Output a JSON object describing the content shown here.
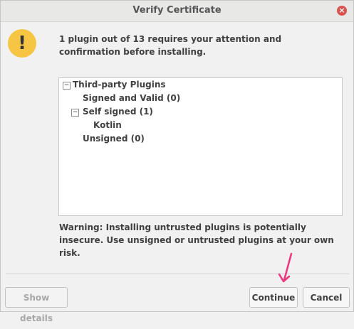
{
  "window": {
    "title": "Verify Certificate",
    "close_icon": "×"
  },
  "message": {
    "icon": "!",
    "text": "1 plugin out of 13 requires your attention and confirmation before installing."
  },
  "tree": {
    "root": {
      "toggle": "−",
      "label": "Third-party Plugins"
    },
    "signed_valid": {
      "label": "Signed and Valid (0)"
    },
    "self_signed": {
      "toggle": "−",
      "label": "Self signed (1)"
    },
    "kotlin": {
      "label": "Kotlin"
    },
    "unsigned": {
      "label": "Unsigned (0)"
    }
  },
  "warning": {
    "text": "Warning: Installing untrusted plugins is potentially insecure. Use unsigned or untrusted plugins at your own risk."
  },
  "buttons": {
    "show_details": "Show details",
    "continue": "Continue",
    "cancel": "Cancel"
  },
  "colors": {
    "annotation_arrow": "#f0357f",
    "warning_icon": "#f6c544",
    "close_button": "#d9534f"
  }
}
